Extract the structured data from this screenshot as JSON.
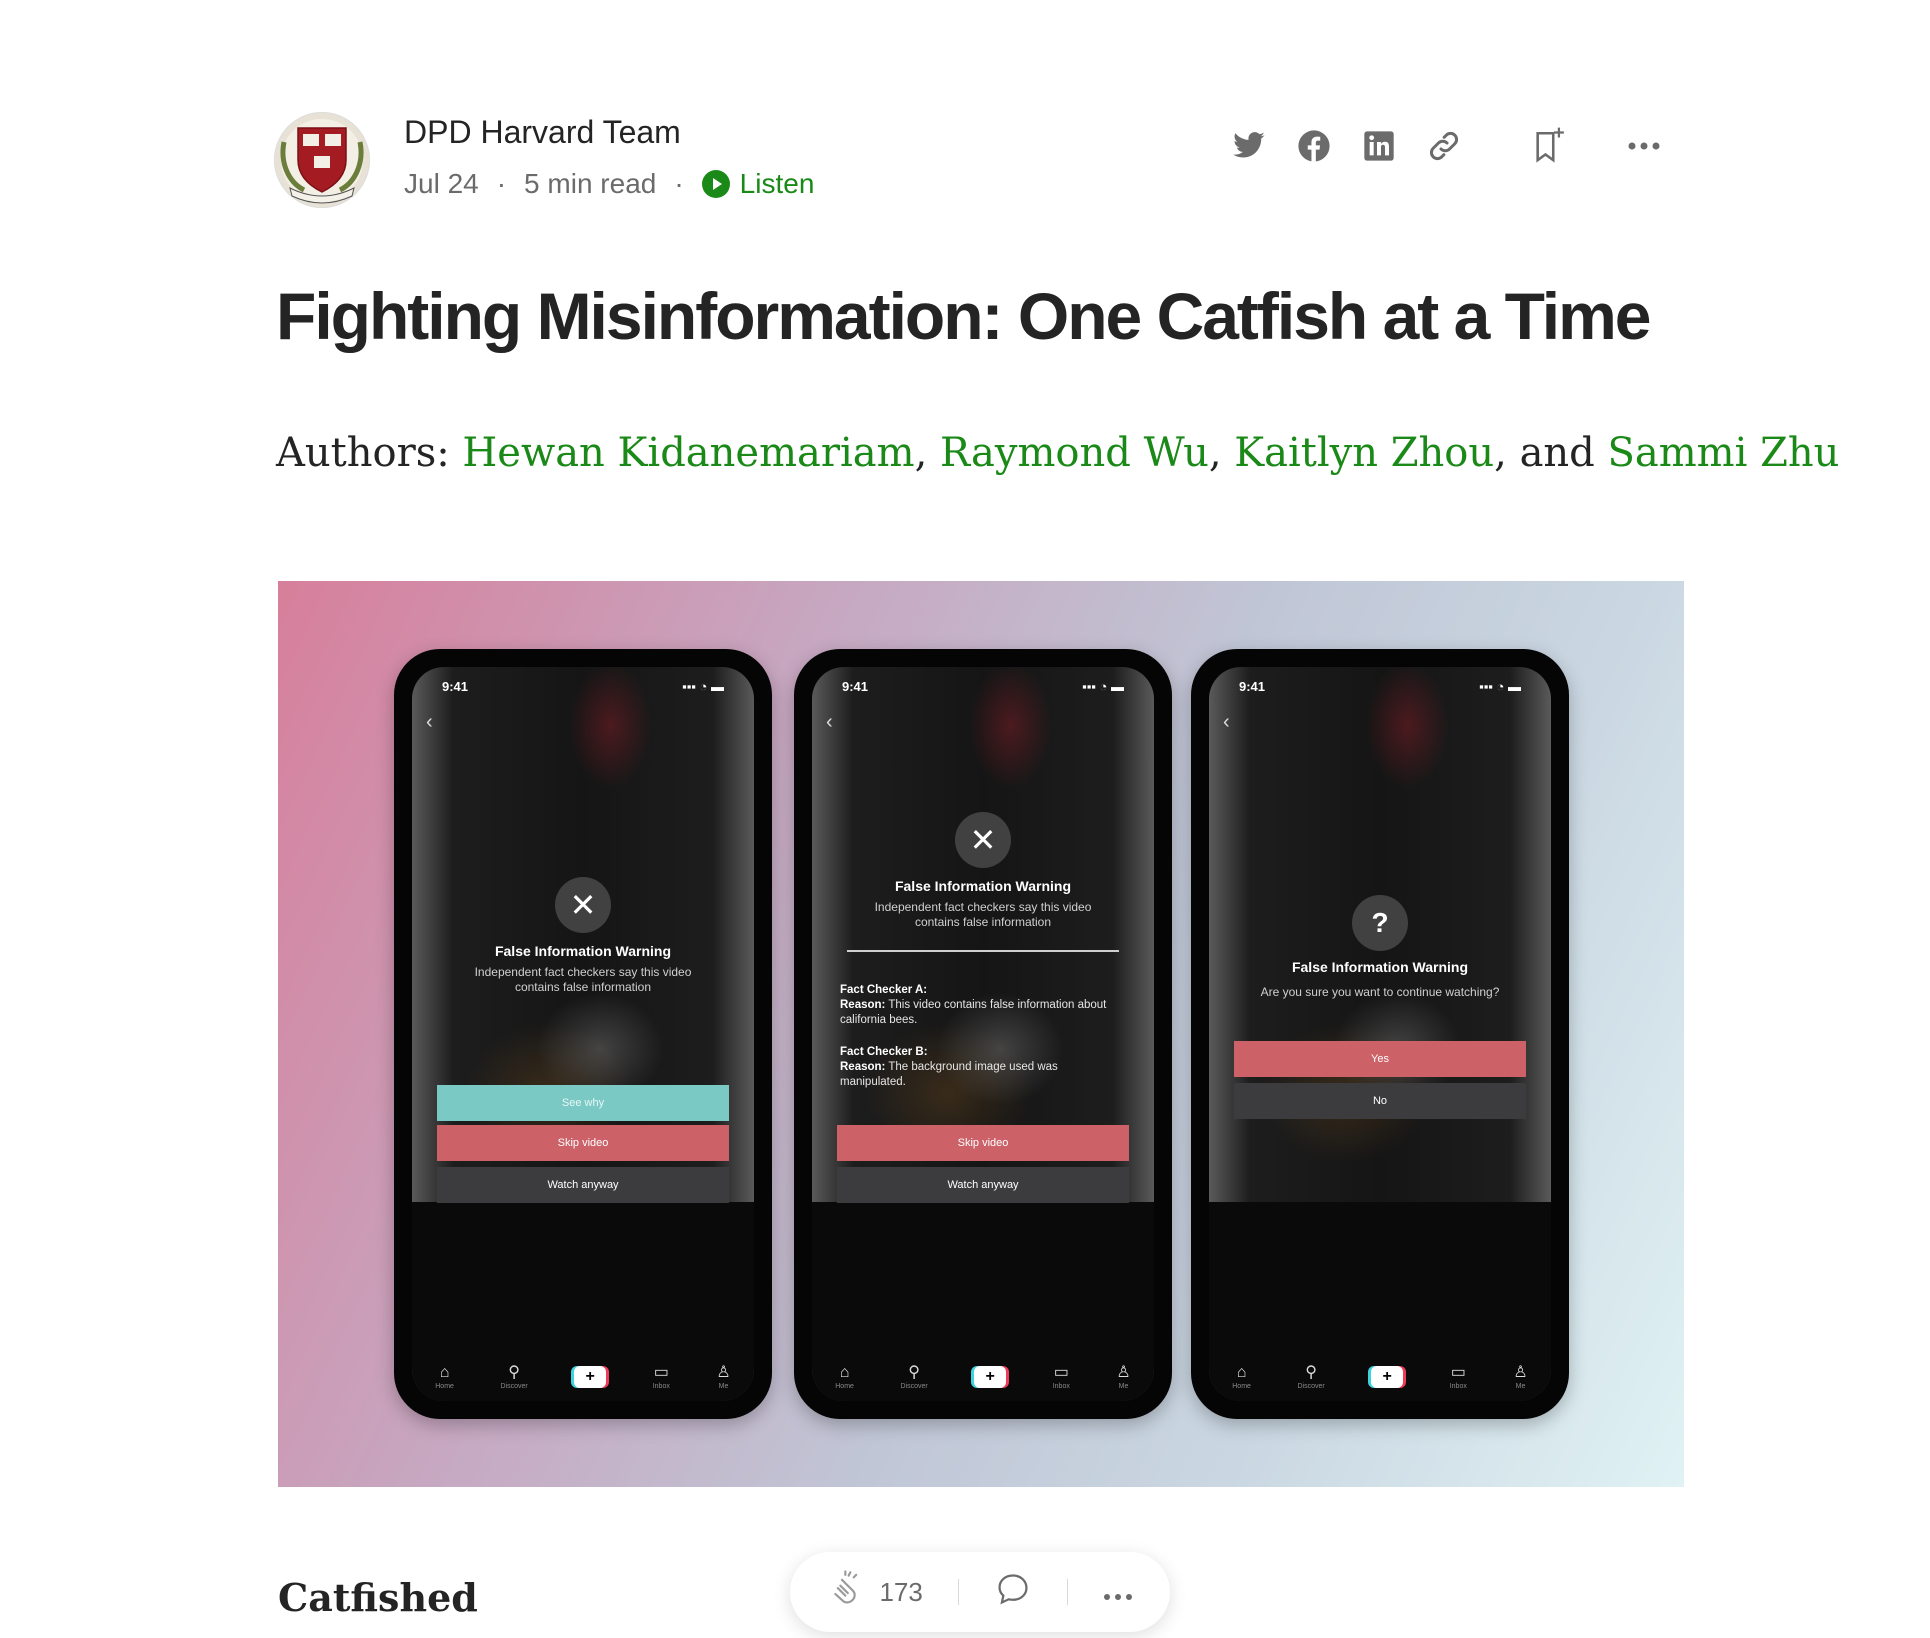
{
  "author": {
    "name": "DPD Harvard Team",
    "date": "Jul 24",
    "read_time": "5 min read",
    "listen_label": "Listen",
    "avatar_text": "HARVARD"
  },
  "actions": {
    "icons": [
      "twitter-icon",
      "facebook-icon",
      "linkedin-icon",
      "link-icon",
      "bookmark-add-icon",
      "more-icon"
    ]
  },
  "article": {
    "title": "Fighting Misinformation: One Catfish at a Time",
    "authors_prefix": "Authors: ",
    "authors": [
      "Hewan Kidanemariam",
      "Raymond Wu",
      "Kaitlyn Zhou",
      "Sammi Zhu"
    ],
    "sep_comma": ", ",
    "sep_and": ", and ",
    "section_heading": "Catfished"
  },
  "phones": [
    {
      "time": "9:41",
      "warning_title": "False Information Warning",
      "warning_sub_1": "Independent fact checkers say this video",
      "warning_sub_2": "contains false information",
      "icon_glyph": "✕",
      "btn_see_why": "See why",
      "btn_skip": "Skip video",
      "btn_watch": "Watch anyway"
    },
    {
      "time": "9:41",
      "warning_title": "False Information Warning",
      "warning_sub_1": "Independent fact checkers say this video",
      "warning_sub_2": "contains false information",
      "icon_glyph": "✕",
      "fact_a_label": "Fact Checker A:",
      "fact_a_reason_label": "Reason:",
      "fact_a_reason": " This video contains false information about california bees.",
      "fact_b_label": "Fact Checker B:",
      "fact_b_reason_label": "Reason:",
      "fact_b_reason": " The background image used was manipulated.",
      "btn_skip": "Skip video",
      "btn_watch": "Watch anyway"
    },
    {
      "time": "9:41",
      "warning_title": "False Information Warning",
      "warning_sub_1": "Are you sure you want to continue watching?",
      "icon_glyph": "?",
      "btn_yes": "Yes",
      "btn_no": "No"
    }
  ],
  "tabbar": {
    "home": "Home",
    "discover": "Discover",
    "inbox": "Inbox",
    "me": "Me"
  },
  "floatbar": {
    "clap_count": "173"
  },
  "colors": {
    "brand_green": "#1a8917",
    "text_primary": "#242424",
    "text_secondary": "#6b6b6b",
    "tiktok_red_button": "#cc6168",
    "tiktok_teal_button": "#7ac9c4"
  }
}
